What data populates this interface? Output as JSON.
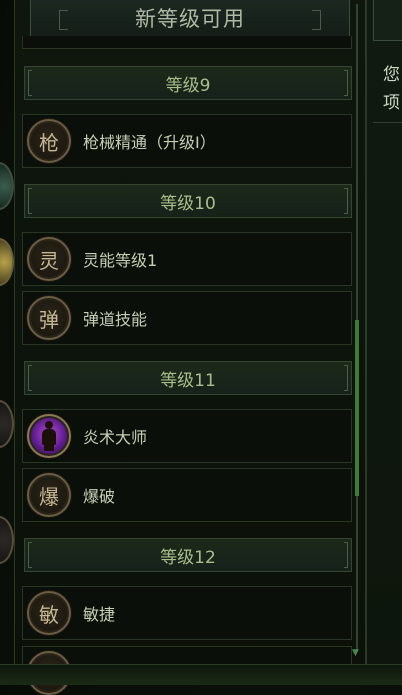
{
  "dialog": {
    "title": "新等级可用"
  },
  "levels": [
    {
      "header": "等级9",
      "items": [
        {
          "badge_char": "枪",
          "label": "枪械精通（升级Ⅰ）",
          "icon": "gun-mastery-icon"
        }
      ]
    },
    {
      "header": "等级10",
      "items": [
        {
          "badge_char": "灵",
          "label": "灵能等级1",
          "icon": "psionic-level-icon"
        },
        {
          "badge_char": "弹",
          "label": "弹道技能",
          "icon": "ballistic-skill-icon"
        }
      ]
    },
    {
      "header": "等级11",
      "items": [
        {
          "badge_char": "",
          "label": "炎术大师",
          "icon": "pyromaster-portrait-icon"
        },
        {
          "badge_char": "爆",
          "label": "爆破",
          "icon": "demolition-icon"
        }
      ]
    },
    {
      "header": "等级12",
      "items": [
        {
          "badge_char": "敏",
          "label": "敏捷",
          "icon": "agility-icon"
        }
      ]
    }
  ],
  "right_panel": {
    "line1": "您",
    "line2": "项"
  }
}
